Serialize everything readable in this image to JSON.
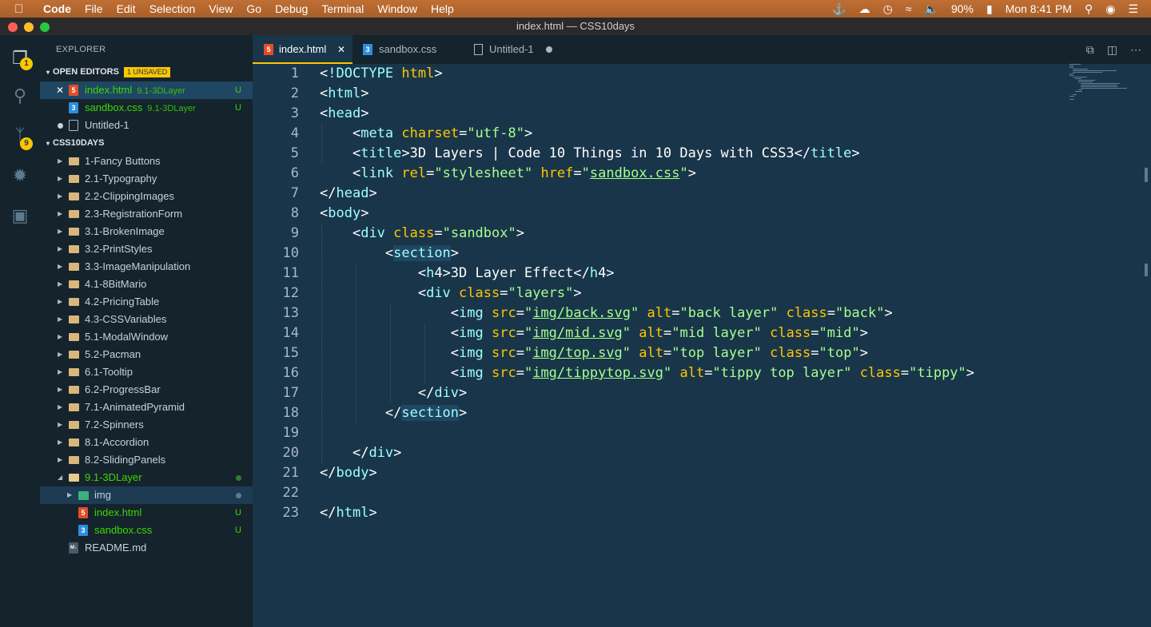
{
  "menubar": {
    "app": "Code",
    "items": [
      "File",
      "Edit",
      "Selection",
      "View",
      "Go",
      "Debug",
      "Terminal",
      "Window",
      "Help"
    ],
    "battery": "90%",
    "clock": "Mon 8:41 PM"
  },
  "window_title": "index.html — CSS10days",
  "activity": {
    "explorer_badge": "1",
    "scm_badge": "9"
  },
  "sidebar": {
    "title": "EXPLORER",
    "open_editors_label": "OPEN EDITORS",
    "unsaved_badge": "1 UNSAVED",
    "open_editors": [
      {
        "name": "index.html",
        "folder": "9.1-3DLayer",
        "status": "U"
      },
      {
        "name": "sandbox.css",
        "folder": "9.1-3DLayer",
        "status": "U"
      },
      {
        "name": "Untitled-1"
      }
    ],
    "project_label": "CSS10DAYS",
    "folders": [
      "1-Fancy Buttons",
      "2.1-Typography",
      "2.2-ClippingImages",
      "2.3-RegistrationForm",
      "3.1-BrokenImage",
      "3.2-PrintStyles",
      "3.3-ImageManipulation",
      "4.1-8BitMario",
      "4.2-PricingTable",
      "4.3-CSSVariables",
      "5.1-ModalWindow",
      "5.2-Pacman",
      "6.1-Tooltip",
      "6.2-ProgressBar",
      "7.1-AnimatedPyramid",
      "7.2-Spinners",
      "8.1-Accordion",
      "8.2-SlidingPanels"
    ],
    "open_folder": "9.1-3DLayer",
    "subfolder": "img",
    "children": [
      {
        "name": "index.html",
        "status": "U"
      },
      {
        "name": "sandbox.css",
        "status": "U"
      }
    ],
    "readme": "README.md"
  },
  "tabs": [
    {
      "label": "index.html",
      "icon": "html-file-icon"
    },
    {
      "label": "sandbox.css",
      "icon": "css-file-icon"
    },
    {
      "label": "Untitled-1",
      "icon": "file-icon"
    }
  ],
  "editor": {
    "line_numbers": [
      "1",
      "2",
      "3",
      "4",
      "5",
      "6",
      "7",
      "8",
      "9",
      "10",
      "11",
      "12",
      "13",
      "14",
      "15",
      "16",
      "17",
      "18",
      "19",
      "20",
      "21",
      "22",
      "23"
    ],
    "lines": [
      "<!DOCTYPE html>",
      "<html>",
      "<head>",
      "    <meta charset=\"utf-8\">",
      "    <title>3D Layers | Code 10 Things in 10 Days with CSS3</title>",
      "    <link rel=\"stylesheet\" href=\"sandbox.css\">",
      "</head>",
      "<body>",
      "    <div class=\"sandbox\">",
      "        <section>",
      "            <h4>3D Layer Effect</h4>",
      "            <div class=\"layers\">",
      "                <img src=\"img/back.svg\" alt=\"back layer\" class=\"back\">",
      "                <img src=\"img/mid.svg\" alt=\"mid layer\" class=\"mid\">",
      "                <img src=\"img/top.svg\" alt=\"top layer\" class=\"top\">",
      "                <img src=\"img/tippytop.svg\" alt=\"tippy top layer\" class=\"tippy\">",
      "            </div>",
      "        </section>",
      "",
      "    </div>",
      "</body>",
      "",
      "</html>"
    ]
  },
  "colors": {
    "editor_bg": "#193549",
    "sidebar_bg": "#15232d",
    "accent": "#ffc600",
    "tag": "#9effff",
    "attr": "#ffc600",
    "string": "#a5ff90",
    "modified": "#3ad900"
  }
}
